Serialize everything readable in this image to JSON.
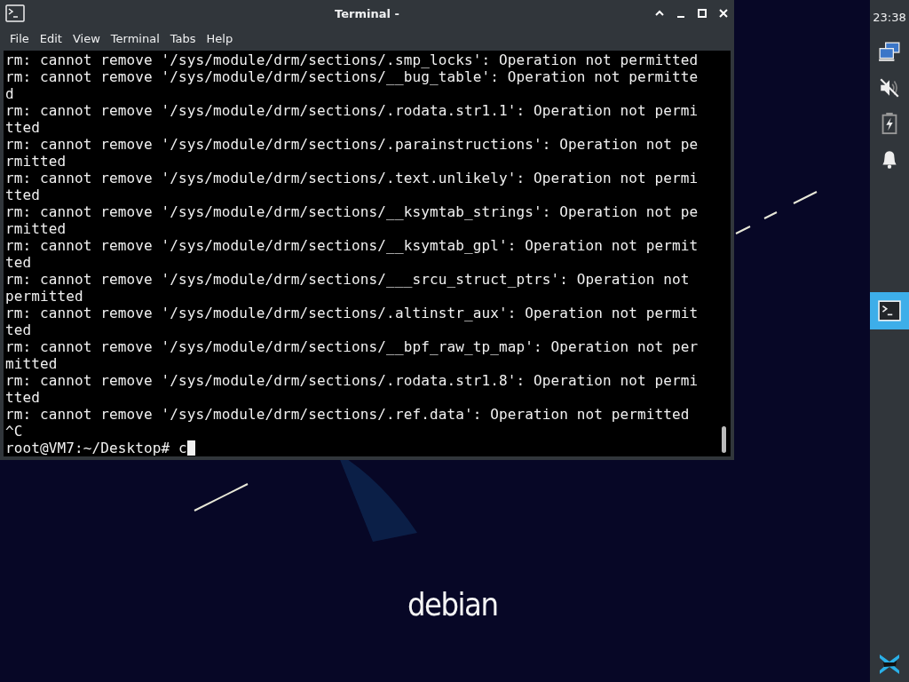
{
  "window": {
    "title": "Terminal -",
    "menu": [
      "File",
      "Edit",
      "View",
      "Terminal",
      "Tabs",
      "Help"
    ],
    "terminal": {
      "lines": [
        "rm: cannot remove '/sys/module/drm/sections/.smp_locks': Operation not permitted",
        "rm: cannot remove '/sys/module/drm/sections/__bug_table': Operation not permitte",
        "d",
        "rm: cannot remove '/sys/module/drm/sections/.rodata.str1.1': Operation not permi",
        "tted",
        "rm: cannot remove '/sys/module/drm/sections/.parainstructions': Operation not pe",
        "rmitted",
        "rm: cannot remove '/sys/module/drm/sections/.text.unlikely': Operation not permi",
        "tted",
        "rm: cannot remove '/sys/module/drm/sections/__ksymtab_strings': Operation not pe",
        "rmitted",
        "rm: cannot remove '/sys/module/drm/sections/__ksymtab_gpl': Operation not permit",
        "ted",
        "rm: cannot remove '/sys/module/drm/sections/___srcu_struct_ptrs': Operation not",
        "permitted",
        "rm: cannot remove '/sys/module/drm/sections/.altinstr_aux': Operation not permit",
        "ted",
        "rm: cannot remove '/sys/module/drm/sections/__bpf_raw_tp_map': Operation not per",
        "mitted",
        "rm: cannot remove '/sys/module/drm/sections/.rodata.str1.8': Operation not permi",
        "tted",
        "rm: cannot remove '/sys/module/drm/sections/.ref.data': Operation not permitted",
        "^C"
      ],
      "prompt": "root@VM7:~/Desktop#",
      "input": "c"
    }
  },
  "desktop": {
    "logo_text": "debian"
  },
  "panel": {
    "clock": "23:38",
    "tasks": [
      {
        "kind": "terminal",
        "selected": true
      }
    ]
  }
}
